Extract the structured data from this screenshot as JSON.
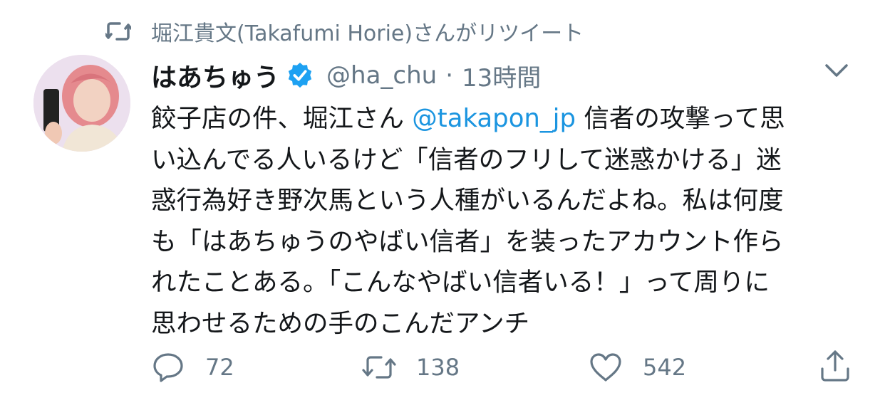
{
  "retweet_banner": "堀江貴文(Takafumi Horie)さんがリツイート",
  "author": {
    "name": "はあちゅう",
    "handle": "@ha_chu",
    "separator": "·",
    "time": "13時間"
  },
  "body_lines": [
    [
      "餃子店の件、堀江さん ",
      "@takapon_jp",
      " 信者の攻撃って思"
    ],
    "い込んでる人いるけど「信者のフリして迷惑かける」迷",
    "惑行為好き野次馬という人種がいるんだよね。私は何度",
    "も「はあちゅうのやばい信者」を装ったアカウント作ら",
    "れたことある。「こんなやばい信者いる！」って周りに",
    "思わせるための手のこんだアンチ"
  ],
  "actions": {
    "reply_count": "72",
    "retweet_count": "138",
    "like_count": "542"
  },
  "icons": {
    "retweet": "retweet-icon",
    "verified": "verified-badge-icon",
    "chevron": "chevron-down-icon",
    "reply": "reply-icon",
    "like": "heart-icon",
    "share": "share-icon"
  },
  "colors": {
    "text": "#14171a",
    "secondary": "#657786",
    "link": "#1b95e0",
    "verified": "#1da1f2"
  }
}
